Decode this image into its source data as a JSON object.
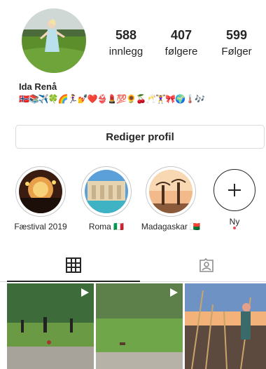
{
  "profile": {
    "name": "Ida Renå",
    "bio_emojis": "🇳🇴📚✈️🍀🌈🏃‍♀️💅❤️👙💄💯🌻🍒🥂🏋️‍♀️🎀🌍🌡️🎶"
  },
  "stats": [
    {
      "value": "588",
      "label": "innlegg"
    },
    {
      "value": "407",
      "label": "følgere"
    },
    {
      "value": "599",
      "label": "Følger"
    }
  ],
  "edit_profile_label": "Rediger profil",
  "highlights": [
    {
      "label": "Fæstival 2019"
    },
    {
      "label": "Roma 🇮🇹"
    },
    {
      "label": "Madagaskar 🇲🇬"
    }
  ],
  "new_highlight": {
    "label": "Ny",
    "plus": "+"
  },
  "tabs": [
    "grid-icon",
    "tagged-icon"
  ],
  "colors": {
    "accent": "#262626",
    "border": "#dbdbdb",
    "notification_dot": "#ed4956"
  }
}
